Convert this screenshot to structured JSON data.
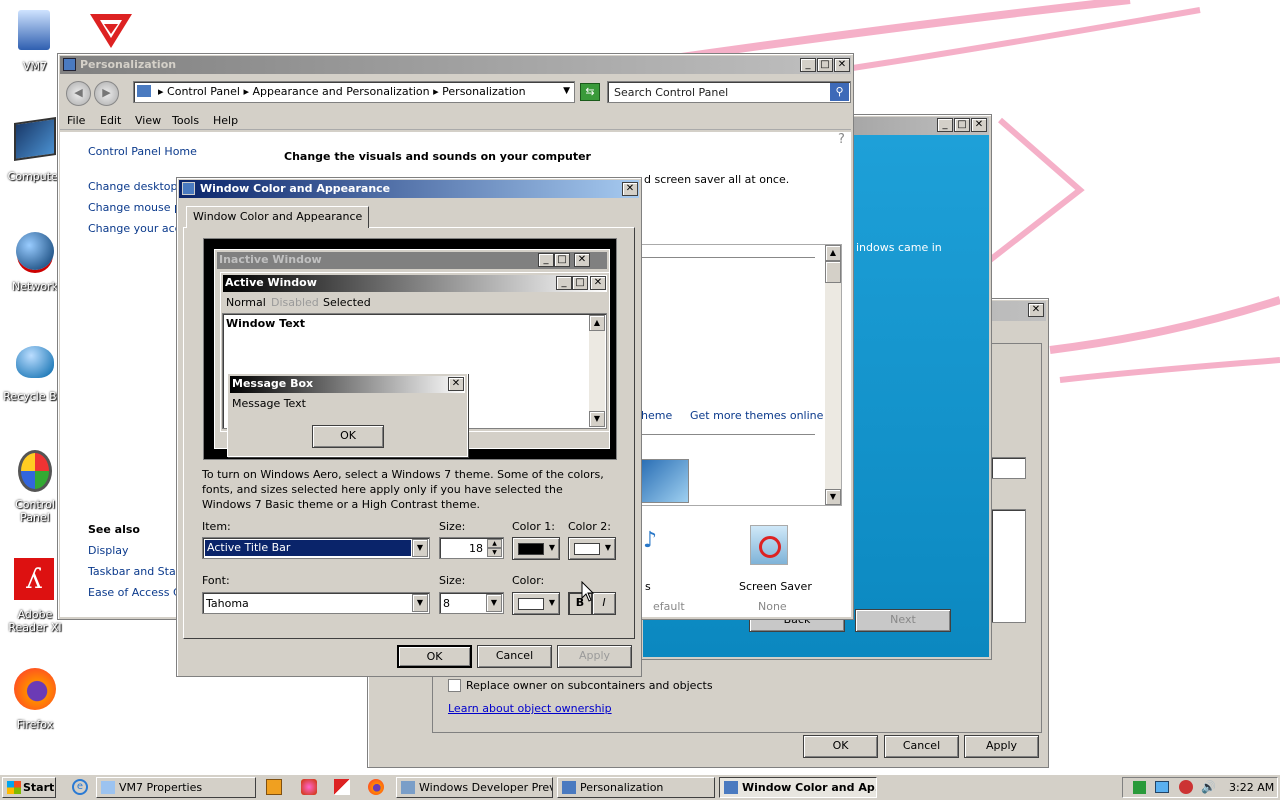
{
  "desktop": {
    "icons": [
      {
        "label": "VM7",
        "icon": "vm-icon"
      },
      {
        "label": "Computer",
        "icon": "computer-icon"
      },
      {
        "label": "Network",
        "icon": "network-icon"
      },
      {
        "label": "Recycle Bin",
        "icon": "recycle-bin-icon"
      },
      {
        "label": "Control Panel",
        "icon": "control-panel-icon"
      },
      {
        "label": "Adobe Reader XI",
        "icon": "adobe-reader-icon"
      },
      {
        "label": "Firefox",
        "icon": "firefox-icon"
      }
    ]
  },
  "personalization": {
    "title": "Personalization",
    "breadcrumb": [
      "Control Panel",
      "Appearance and Personalization",
      "Personalization"
    ],
    "search_placeholder": "Search Control Panel",
    "menu": [
      "File",
      "Edit",
      "View",
      "Tools",
      "Help"
    ],
    "left_links": [
      "Control Panel Home",
      "Change desktop ic",
      "Change mouse poi",
      "Change your accou"
    ],
    "see_also_title": "See also",
    "see_also": [
      "Display",
      "Taskbar and Start",
      "Ease of Access Ce"
    ],
    "heading": "Change the visuals and sounds on your computer",
    "subtext": "Click a theme to change the desktop background, window color, sounds, and screen saver all at once.",
    "subtext_visible": "d screen saver all at once.",
    "theme_link": "heme",
    "get_more_themes": "Get more themes online",
    "screen_saver_label": "Screen Saver",
    "screen_saver_value": "None",
    "sounds_suffix": "s",
    "sounds_value": "efault"
  },
  "background_windows": {
    "blue_text": "indows came in",
    "back_label": "Back",
    "next_label": "Next",
    "replace_owner_label": "Replace owner on subcontainers and objects",
    "learn_link": "Learn about object ownership",
    "ok_label": "OK",
    "cancel_label": "Cancel",
    "apply_label": "Apply"
  },
  "dialog": {
    "title": "Window Color and Appearance",
    "tab": "Window Color and Appearance",
    "preview": {
      "inactive_title": "Inactive Window",
      "active_title": "Active Window",
      "menu_normal": "Normal",
      "menu_disabled": "Disabled",
      "menu_selected": "Selected",
      "window_text": "Window Text",
      "msgbox_title": "Message Box",
      "msgbox_text": "Message Text",
      "msgbox_ok": "OK"
    },
    "description": "To turn on Windows Aero, select a Windows 7 theme.  Some of the colors, fonts, and sizes selected here apply only if you have selected the Windows 7 Basic theme or a High Contrast theme.",
    "item_label": "Item:",
    "item_value": "Active Title Bar",
    "size_label": "Size:",
    "size_value": "18",
    "color1_label": "Color 1:",
    "color2_label": "Color 2:",
    "color1": "#000000",
    "color2": "#ffffff",
    "font_label": "Font:",
    "font_value": "Tahoma",
    "font_size_label": "Size:",
    "font_size_value": "8",
    "font_color_label": "Color:",
    "font_color": "#ffffff",
    "bold_label": "B",
    "italic_label": "I",
    "ok_label": "OK",
    "cancel_label": "Cancel",
    "apply_label": "Apply"
  },
  "taskbar": {
    "start_label": "Start",
    "items": [
      "VM7 Properties",
      "Windows Developer Prev...",
      "Personalization",
      "Window Color and Ap..."
    ],
    "clock": "3:22 AM"
  },
  "colors": {
    "title_active_start": "#0a246a",
    "title_inactive": "#808080",
    "blue_panel": "#0a9dd0",
    "pink_stroke": "#f2a0c0"
  }
}
